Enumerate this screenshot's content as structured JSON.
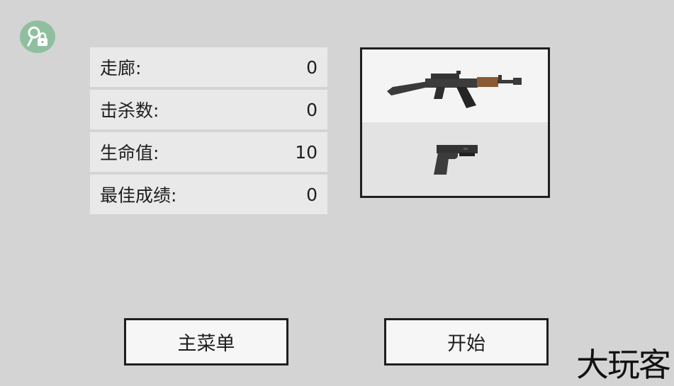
{
  "stats": [
    {
      "label": "走廊:",
      "value": "0"
    },
    {
      "label": "击杀数:",
      "value": "0"
    },
    {
      "label": "生命值:",
      "value": "10"
    },
    {
      "label": "最佳成绩:",
      "value": "0"
    }
  ],
  "weapons": {
    "primary": "rifle-icon",
    "secondary": "pistol-icon"
  },
  "buttons": {
    "main_menu": "主菜单",
    "start": "开始"
  },
  "watermark": "大玩客",
  "colors": {
    "background": "#d4d4d4",
    "key_button": "#8fbf9f",
    "stock_wood": "#8a5a34"
  }
}
